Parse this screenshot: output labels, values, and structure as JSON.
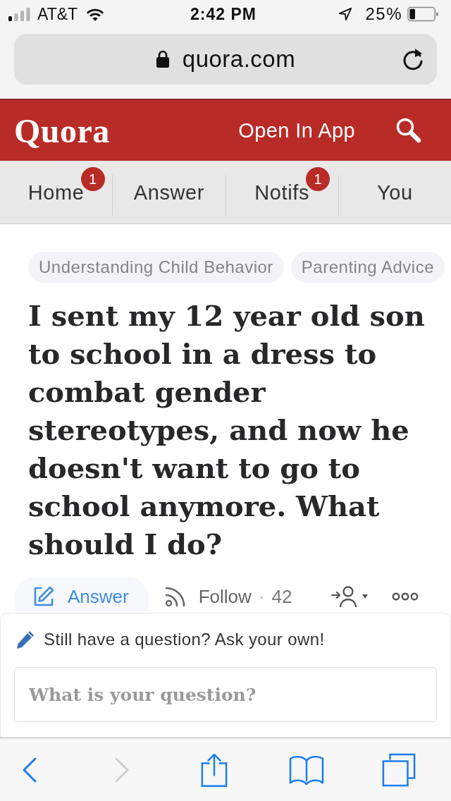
{
  "status_bar": {
    "carrier": "AT&T",
    "time": "2:42 PM",
    "battery": "25%"
  },
  "address_bar": {
    "url": "quora.com"
  },
  "header": {
    "logo": "Quora",
    "open_in_app": "Open In App"
  },
  "nav_tabs": [
    {
      "label": "Home",
      "badge": "1"
    },
    {
      "label": "Answer"
    },
    {
      "label": "Notifs",
      "badge": "1"
    },
    {
      "label": "You"
    }
  ],
  "topics": [
    {
      "label": "Understanding Child Behavior"
    },
    {
      "label": "Parenting Advice"
    }
  ],
  "question": {
    "title": "I sent my 12 year old son to school in a dress to combat gender stereotypes, and now he doesn't want to go to school anymore. What should I do?"
  },
  "actions": {
    "answer": "Answer",
    "follow": "Follow",
    "separator": "·",
    "follower_count": "42"
  },
  "ask_card": {
    "prompt": "Still have a question? Ask your own!",
    "placeholder": "What is your question?"
  },
  "toolbar": [
    {
      "kind": "back",
      "disabled": false
    },
    {
      "kind": "forward",
      "disabled": true
    },
    {
      "kind": "share",
      "disabled": false
    },
    {
      "kind": "bookmarks",
      "disabled": false
    },
    {
      "kind": "tabs",
      "disabled": false
    }
  ]
}
